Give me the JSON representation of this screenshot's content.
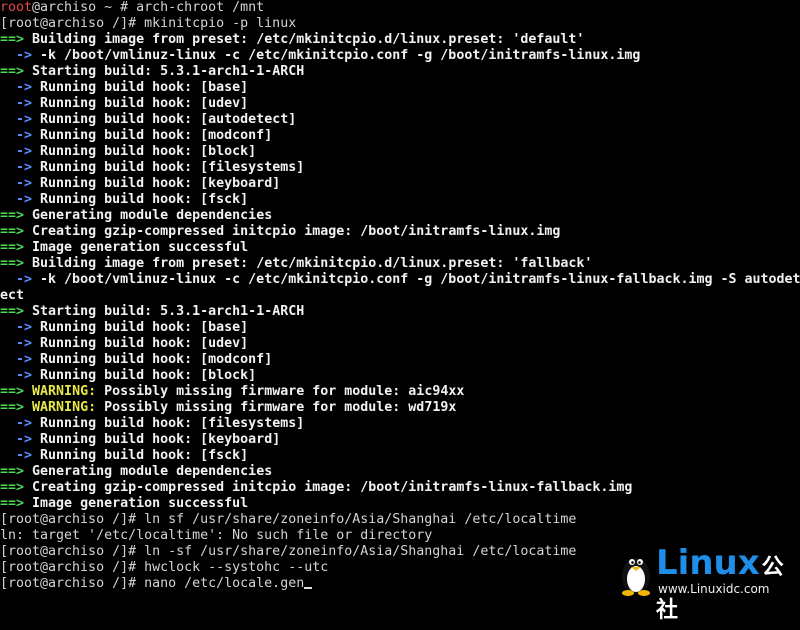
{
  "terminal": {
    "lines": [
      [
        {
          "t": "root",
          "c": "c-red"
        },
        {
          "t": "@archiso ~ # arch-chroot /mnt",
          "c": "c-default"
        }
      ],
      [
        {
          "t": "[root@archiso /]# mkinitcpio -p linux",
          "c": "c-default"
        }
      ],
      [
        {
          "t": "==>",
          "c": "c-green"
        },
        {
          "t": " Building image from preset: /etc/mkinitcpio.d/linux.preset: 'default'",
          "c": "c-bold"
        }
      ],
      [
        {
          "t": "  ->",
          "c": "c-blue"
        },
        {
          "t": " -k /boot/vmlinuz-linux -c /etc/mkinitcpio.conf -g /boot/initramfs-linux.img",
          "c": "c-bold"
        }
      ],
      [
        {
          "t": "==>",
          "c": "c-green"
        },
        {
          "t": " Starting build: 5.3.1-arch1-1-ARCH",
          "c": "c-bold"
        }
      ],
      [
        {
          "t": "  ->",
          "c": "c-blue"
        },
        {
          "t": " Running build hook: [base]",
          "c": "c-bold"
        }
      ],
      [
        {
          "t": "  ->",
          "c": "c-blue"
        },
        {
          "t": " Running build hook: [udev]",
          "c": "c-bold"
        }
      ],
      [
        {
          "t": "  ->",
          "c": "c-blue"
        },
        {
          "t": " Running build hook: [autodetect]",
          "c": "c-bold"
        }
      ],
      [
        {
          "t": "  ->",
          "c": "c-blue"
        },
        {
          "t": " Running build hook: [modconf]",
          "c": "c-bold"
        }
      ],
      [
        {
          "t": "  ->",
          "c": "c-blue"
        },
        {
          "t": " Running build hook: [block]",
          "c": "c-bold"
        }
      ],
      [
        {
          "t": "  ->",
          "c": "c-blue"
        },
        {
          "t": " Running build hook: [filesystems]",
          "c": "c-bold"
        }
      ],
      [
        {
          "t": "  ->",
          "c": "c-blue"
        },
        {
          "t": " Running build hook: [keyboard]",
          "c": "c-bold"
        }
      ],
      [
        {
          "t": "  ->",
          "c": "c-blue"
        },
        {
          "t": " Running build hook: [fsck]",
          "c": "c-bold"
        }
      ],
      [
        {
          "t": "==>",
          "c": "c-green"
        },
        {
          "t": " Generating module dependencies",
          "c": "c-bold"
        }
      ],
      [
        {
          "t": "==>",
          "c": "c-green"
        },
        {
          "t": " Creating gzip-compressed initcpio image: /boot/initramfs-linux.img",
          "c": "c-bold"
        }
      ],
      [
        {
          "t": "==>",
          "c": "c-green"
        },
        {
          "t": " Image generation successful",
          "c": "c-bold"
        }
      ],
      [
        {
          "t": "==>",
          "c": "c-green"
        },
        {
          "t": " Building image from preset: /etc/mkinitcpio.d/linux.preset: 'fallback'",
          "c": "c-bold"
        }
      ],
      [
        {
          "t": "  ->",
          "c": "c-blue"
        },
        {
          "t": " -k /boot/vmlinuz-linux -c /etc/mkinitcpio.conf -g /boot/initramfs-linux-fallback.img -S autodet",
          "c": "c-bold"
        }
      ],
      [
        {
          "t": "ect",
          "c": "c-bold"
        }
      ],
      [
        {
          "t": "==>",
          "c": "c-green"
        },
        {
          "t": " Starting build: 5.3.1-arch1-1-ARCH",
          "c": "c-bold"
        }
      ],
      [
        {
          "t": "  ->",
          "c": "c-blue"
        },
        {
          "t": " Running build hook: [base]",
          "c": "c-bold"
        }
      ],
      [
        {
          "t": "  ->",
          "c": "c-blue"
        },
        {
          "t": " Running build hook: [udev]",
          "c": "c-bold"
        }
      ],
      [
        {
          "t": "  ->",
          "c": "c-blue"
        },
        {
          "t": " Running build hook: [modconf]",
          "c": "c-bold"
        }
      ],
      [
        {
          "t": "  ->",
          "c": "c-blue"
        },
        {
          "t": " Running build hook: [block]",
          "c": "c-bold"
        }
      ],
      [
        {
          "t": "==>",
          "c": "c-green"
        },
        {
          "t": " WARNING:",
          "c": "c-yellow"
        },
        {
          "t": " Possibly missing firmware for module: aic94xx",
          "c": "c-bold"
        }
      ],
      [
        {
          "t": "==>",
          "c": "c-green"
        },
        {
          "t": " WARNING:",
          "c": "c-yellow"
        },
        {
          "t": " Possibly missing firmware for module: wd719x",
          "c": "c-bold"
        }
      ],
      [
        {
          "t": "  ->",
          "c": "c-blue"
        },
        {
          "t": " Running build hook: [filesystems]",
          "c": "c-bold"
        }
      ],
      [
        {
          "t": "  ->",
          "c": "c-blue"
        },
        {
          "t": " Running build hook: [keyboard]",
          "c": "c-bold"
        }
      ],
      [
        {
          "t": "  ->",
          "c": "c-blue"
        },
        {
          "t": " Running build hook: [fsck]",
          "c": "c-bold"
        }
      ],
      [
        {
          "t": "==>",
          "c": "c-green"
        },
        {
          "t": " Generating module dependencies",
          "c": "c-bold"
        }
      ],
      [
        {
          "t": "==>",
          "c": "c-green"
        },
        {
          "t": " Creating gzip-compressed initcpio image: /boot/initramfs-linux-fallback.img",
          "c": "c-bold"
        }
      ],
      [
        {
          "t": "==>",
          "c": "c-green"
        },
        {
          "t": " Image generation successful",
          "c": "c-bold"
        }
      ],
      [
        {
          "t": "[root@archiso /]# ln sf /usr/share/zoneinfo/Asia/Shanghai /etc/localtime",
          "c": "c-default"
        }
      ],
      [
        {
          "t": "ln: target '/etc/localtime': No such file or directory",
          "c": "c-default"
        }
      ],
      [
        {
          "t": "[root@archiso /]# ln -sf /usr/share/zoneinfo/Asia/Shanghai /etc/locatime",
          "c": "c-default"
        }
      ],
      [
        {
          "t": "[root@archiso /]# hwclock --systohc --utc",
          "c": "c-default"
        }
      ],
      [
        {
          "t": "[root@archiso /]# nano /etc/locale.gen",
          "c": "c-default"
        }
      ]
    ],
    "colors": {
      "background": "#000000",
      "prompt_user": "#e84848",
      "arrow_major": "#54d854",
      "arrow_minor": "#5c8cff",
      "warning": "#e8e848",
      "text": "#f2f2f2"
    }
  },
  "watermark": {
    "logo_icon": "tux-penguin-icon",
    "title": "Linux",
    "title_cn": "公社",
    "url": "www.Linuxidc.com"
  }
}
